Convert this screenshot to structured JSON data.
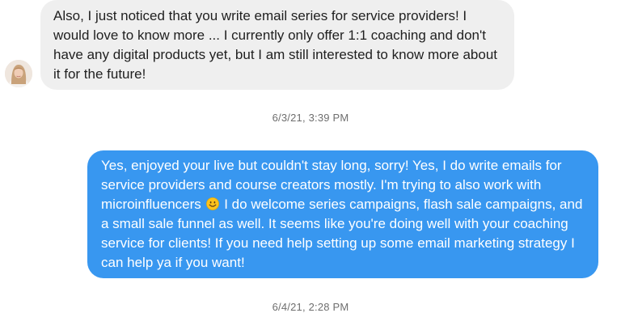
{
  "messages": [
    {
      "direction": "incoming",
      "text": "Also, I just noticed that you write email series for service providers! I would love to know more ... I currently only offer 1:1 coaching and don't have any digital products yet, but I am still interested to know more about it for the future!"
    },
    {
      "direction": "outgoing",
      "text_before_emoji": "Yes, enjoyed your live but couldn't stay long, sorry! Yes, I do write emails for service providers and course creators mostly. I'm trying to also work with microinfluencers",
      "emoji_icon": "smiling-face-emoji",
      "text_after_emoji": "I do welcome series campaigns, flash sale campaigns, and a small sale funnel as well. It seems like you're doing well with your coaching service for clients! If you need help setting up some email marketing strategy I can help ya if you want!"
    }
  ],
  "timestamps": {
    "first": "6/3/21, 3:39 PM",
    "second": "6/4/21, 2:28 PM"
  },
  "colors": {
    "incoming_bubble": "#efefef",
    "outgoing_bubble": "#3897f0",
    "timestamp_text": "#6e6e6e"
  }
}
